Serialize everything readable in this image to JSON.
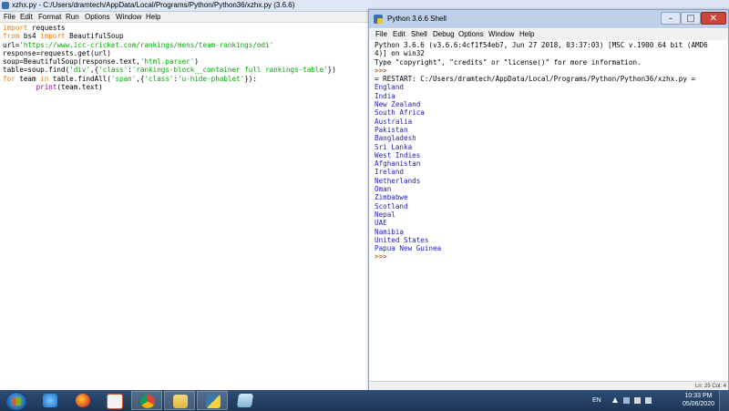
{
  "editor": {
    "title": "xzhx.py - C:/Users/dramtech/AppData/Local/Programs/Python/Python36/xzhx.py (3.6.6)",
    "menu": [
      "File",
      "Edit",
      "Format",
      "Run",
      "Options",
      "Window",
      "Help"
    ],
    "code_lines": [
      "import requests",
      "from bs4 import BeautifulSoup",
      "url='https://www.icc-cricket.com/rankings/mens/team-rankings/odi'",
      "response=requests.get(url)",
      "soup=BeautifulSoup(response.text,'html.parser')",
      "table=soup.find('div',{'class':'rankings-block__container full rankings-table'})",
      "for team in table.findAll('span',{'class':'u-hide-phablet'}):",
      "        print(team.text)"
    ]
  },
  "shell": {
    "title": "Python 3.6.6 Shell",
    "menu": [
      "File",
      "Edit",
      "Shell",
      "Debug",
      "Options",
      "Window",
      "Help"
    ],
    "banner": [
      "Python 3.6.6 (v3.6.6:4cf1f54eb7, Jun 27 2018, 03:37:03) [MSC v.1900 64 bit (AMD6",
      "4)] on win32",
      "Type \"copyright\", \"credits\" or \"license()\" for more information."
    ],
    "prompt": ">>>",
    "restart_line": "= RESTART: C:/Users/dramtech/AppData/Local/Programs/Python/Python36/xzhx.py =",
    "teams": [
      "England",
      "India",
      "New Zealand",
      "South Africa",
      "Australia",
      "Pakistan",
      "Bangladesh",
      "Sri Lanka",
      "West Indies",
      "Afghanistan",
      "Ireland",
      "Netherlands",
      "Oman",
      "Zimbabwe",
      "Scotland",
      "Nepal",
      "UAE",
      "Namibia",
      "United States",
      "Papua New Guinea"
    ],
    "status": "Ln: 25  Col: 4"
  },
  "taskbar": {
    "language": "EN",
    "time": "10:33 PM",
    "date": "05/06/2020"
  }
}
